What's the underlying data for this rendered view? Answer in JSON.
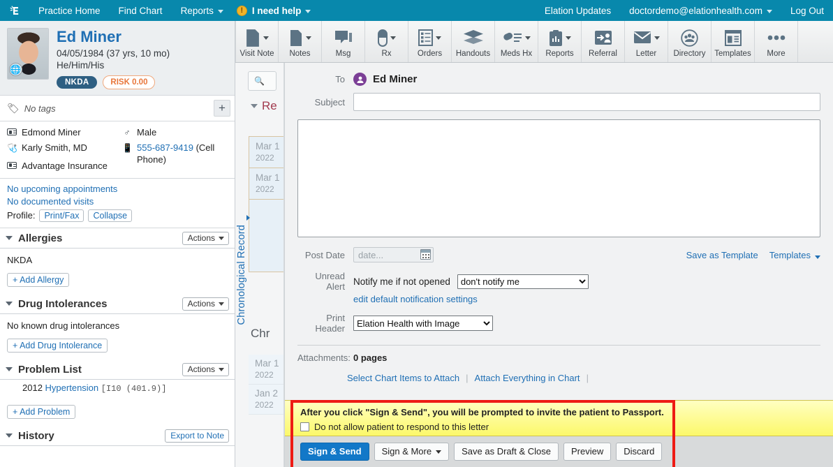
{
  "topnav": {
    "logo_icon": "elation-logo-icon",
    "left_items": [
      {
        "label": "Practice Home",
        "caret": false
      },
      {
        "label": "Find Chart",
        "caret": false
      },
      {
        "label": "Reports",
        "caret": true
      }
    ],
    "help": {
      "label": "I need help",
      "icon": "alert-exclamation-icon",
      "icon_glyph": "!"
    },
    "right_items": [
      {
        "label": "Elation Updates",
        "caret": false
      },
      {
        "label": "doctordemo@elationhealth.com",
        "caret": true
      },
      {
        "label": "Log Out",
        "caret": false
      }
    ],
    "bg_color": "#0888ac"
  },
  "patient": {
    "name": "Ed Miner",
    "dob_age": "04/05/1984 (37 yrs, 10 mo)",
    "pronouns": "He/Him/His",
    "badges": {
      "nkda": "NKDA",
      "risk": "RISK 0.00",
      "nkda_color": "#2e5f82",
      "risk_color": "#e8763a"
    },
    "avatar_icon": "patient-photo",
    "globe_icon": "globe-icon",
    "tags": {
      "label": "No tags",
      "tag_icon": "tag-icon",
      "add_icon": "plus-icon"
    },
    "demographics": {
      "legal_name": "Edmond Miner",
      "legal_name_icon": "id-card-icon",
      "provider": "Karly Smith, MD",
      "provider_icon": "stethoscope-icon",
      "insurance": "Advantage Insurance",
      "insurance_icon": "insurance-card-icon",
      "sex": "Male",
      "sex_icon": "male-gender-icon",
      "phone_number": "555-687-9419",
      "phone_type": "(Cell Phone)",
      "phone_icon": "mobile-phone-icon"
    },
    "appointments": {
      "upcoming": "No upcoming appointments",
      "visits": "No documented visits",
      "profile_label": "Profile:",
      "print_fax": "Print/Fax",
      "collapse": "Collapse"
    }
  },
  "sections": [
    {
      "id": "allergies",
      "title": "Allergies",
      "actions_label": "Actions",
      "body_text": "NKDA",
      "add_label": "+ Add Allergy"
    },
    {
      "id": "drug-intolerances",
      "title": "Drug Intolerances",
      "actions_label": "Actions",
      "body_text": "No known drug intolerances",
      "add_label": "+ Add Drug Intolerance"
    },
    {
      "id": "problem-list",
      "title": "Problem List",
      "actions_label": "Actions",
      "problem": {
        "year": "2012",
        "name": "Hypertension",
        "code": "[I10 (401.9)]"
      },
      "add_label": "+ Add Problem"
    },
    {
      "id": "history",
      "title": "History",
      "export_label": "Export to Note"
    }
  ],
  "chart_toolbar": [
    {
      "label": "Visit Note",
      "icon": "visit-note-icon",
      "caret": true
    },
    {
      "label": "Notes",
      "icon": "notes-page-icon",
      "caret": true
    },
    {
      "label": "Msg",
      "icon": "message-bubble-icon",
      "caret": false
    },
    {
      "label": "Rx",
      "icon": "pill-capsule-icon",
      "caret": true
    },
    {
      "label": "Orders",
      "icon": "orders-list-icon",
      "caret": true
    },
    {
      "label": "Handouts",
      "icon": "handouts-stack-icon",
      "caret": false
    },
    {
      "label": "Meds Hx",
      "icon": "meds-history-icon",
      "caret": true
    },
    {
      "label": "Reports",
      "icon": "reports-clipboard-icon",
      "caret": true
    },
    {
      "label": "Referral",
      "icon": "referral-person-icon",
      "caret": false
    },
    {
      "label": "Letter",
      "icon": "letter-envelope-icon",
      "caret": true
    },
    {
      "label": "Directory",
      "icon": "directory-group-icon",
      "caret": false
    },
    {
      "label": "Templates",
      "icon": "templates-layout-icon",
      "caret": false
    },
    {
      "label": "More",
      "icon": "more-dots-icon",
      "caret": false
    }
  ],
  "chrono_rail": {
    "search_icon": "search-icon",
    "search_placeholder": "",
    "vertical_label": "Chronological Record",
    "recent_title": "Re",
    "recent_entries": [
      {
        "date": "Mar 1",
        "year": "2022"
      },
      {
        "date": "Mar 1",
        "year": "2022"
      }
    ],
    "chrono_title": "Chr",
    "chrono_entries": [
      {
        "date": "Mar 1",
        "year": "2022"
      },
      {
        "date": "Jan 2",
        "year": "2022"
      }
    ]
  },
  "composer": {
    "to_label": "To",
    "to_name": "Ed Miner",
    "to_avatar_icon": "person-circle-icon",
    "subject_label": "Subject",
    "subject_value": "",
    "subject_placeholder": "",
    "body_value": "",
    "post_date_label": "Post Date",
    "post_date_placeholder": "date...",
    "post_date_value": "",
    "calendar_icon": "calendar-icon",
    "save_as_template": "Save as Template",
    "templates_label": "Templates",
    "unread_alert_label": "Unread Alert",
    "notify_text": "Notify me if not opened",
    "notify_selected": "don't notify me",
    "notify_options": [
      "don't notify me"
    ],
    "edit_notification_link": "edit default notification settings",
    "print_header_label": "Print Header",
    "print_header_selected": "Elation Health with Image",
    "print_header_options": [
      "Elation Health with Image"
    ],
    "attachments_label": "Attachments:",
    "attachments_count": "0 pages",
    "select_chart_items": "Select Chart Items to Attach",
    "attach_everything": "Attach Everything in Chart"
  },
  "passport_banner": {
    "message": "After you click \"Sign & Send\", you will be prompted to invite the patient to Passport.",
    "checkbox_label": "Do not allow patient to respond to this letter",
    "checkbox_checked": false,
    "bg_color": "#fcf86a",
    "highlight_color": "#ee1b14"
  },
  "action_buttons": [
    {
      "label": "Sign & Send",
      "style": "primary",
      "caret": false
    },
    {
      "label": "Sign & More",
      "style": "default",
      "caret": true
    },
    {
      "label": "Save as Draft & Close",
      "style": "default",
      "caret": false
    },
    {
      "label": "Preview",
      "style": "default",
      "caret": false
    },
    {
      "label": "Discard",
      "style": "default",
      "caret": false
    }
  ]
}
